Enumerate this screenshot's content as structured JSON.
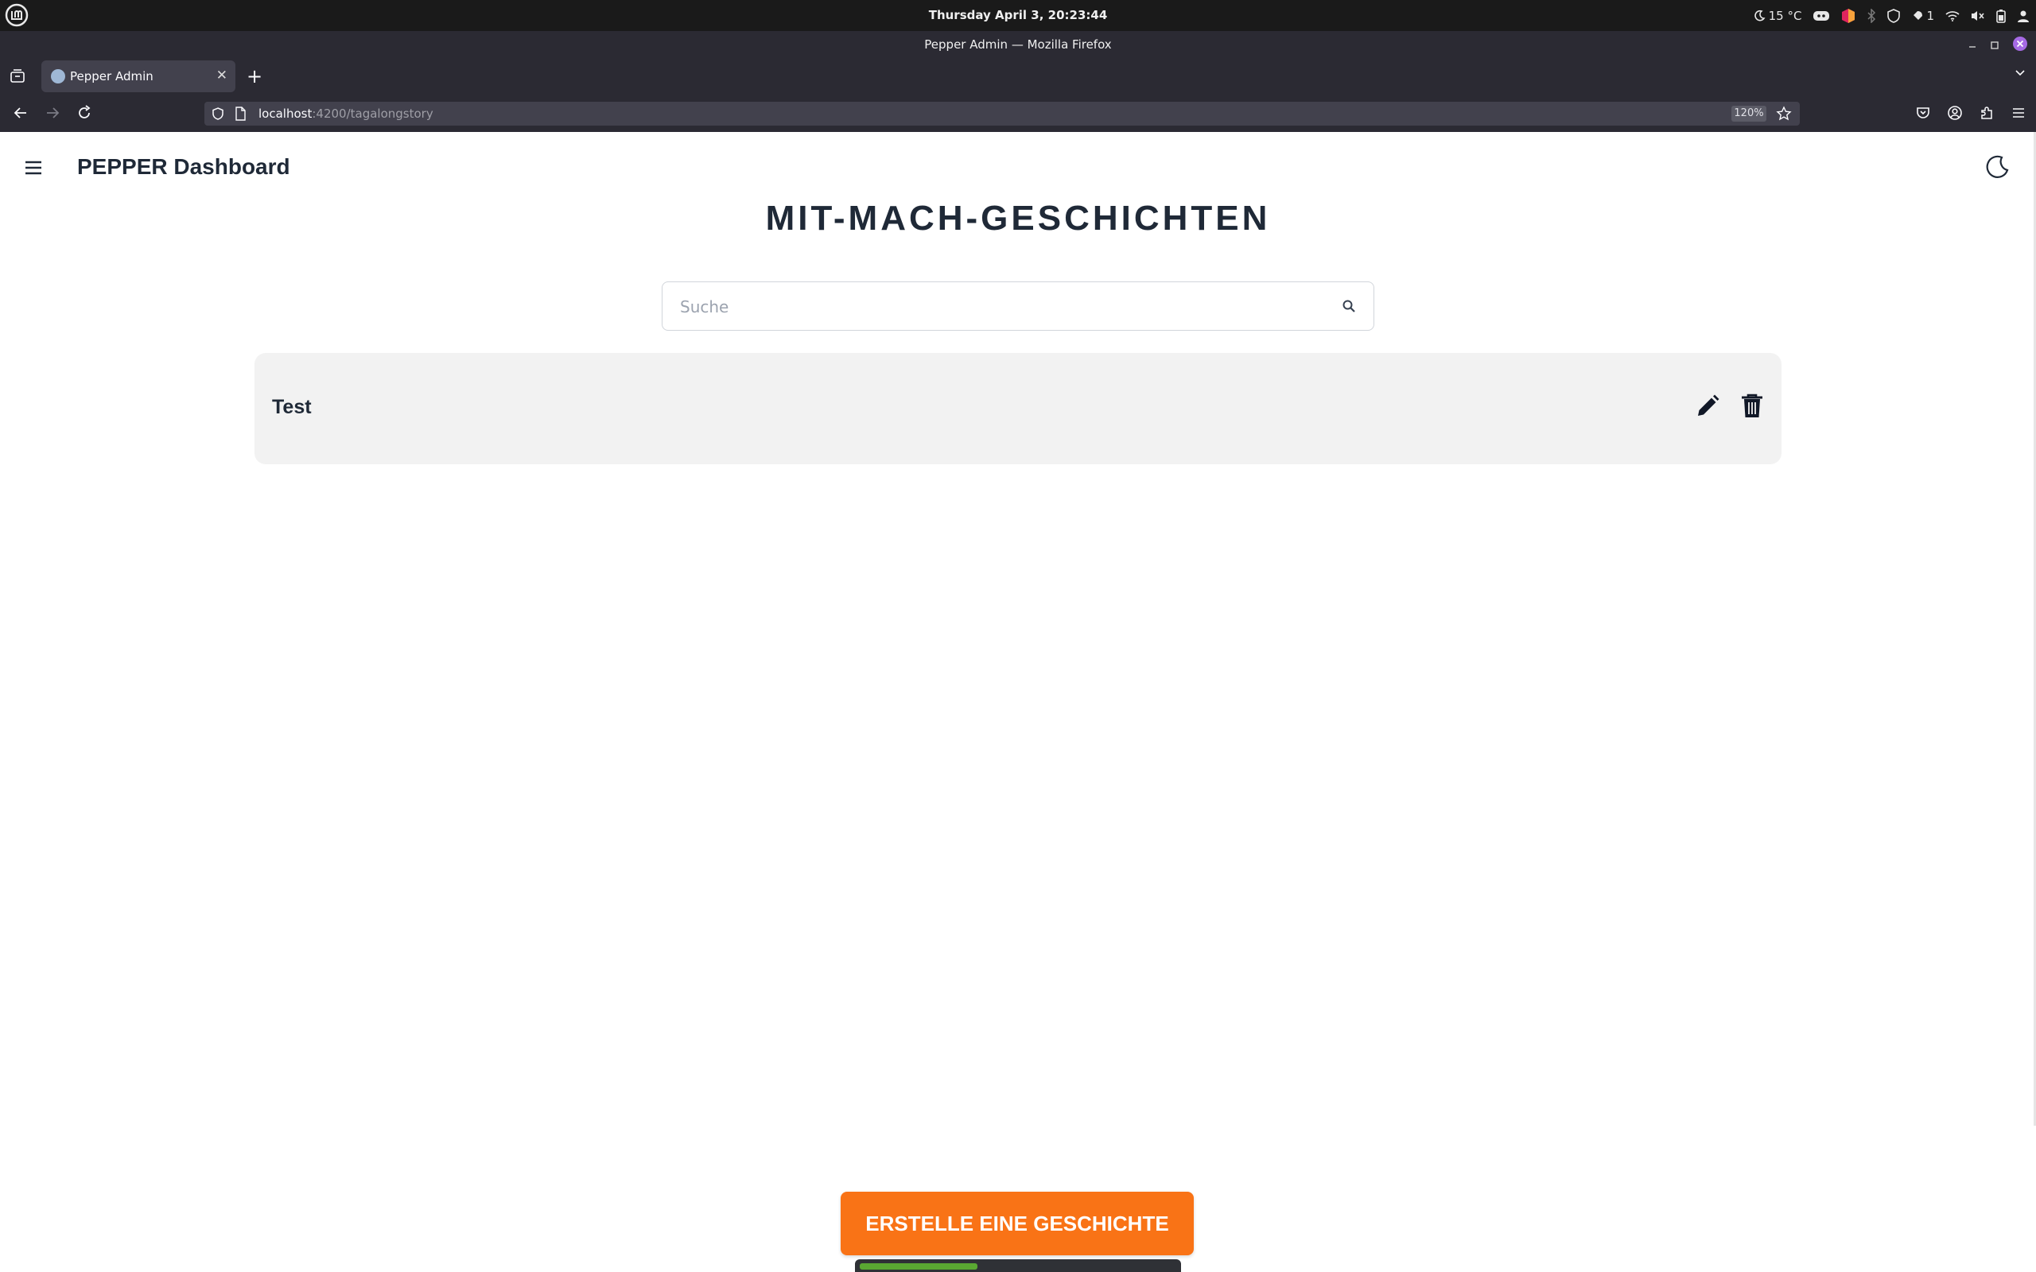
{
  "os": {
    "clock": "Thursday April 3, 20:23:44",
    "weather": "15 °C",
    "notifications": "1"
  },
  "window": {
    "title": "Pepper Admin — Mozilla Firefox"
  },
  "browser": {
    "tab_title": "Pepper Admin",
    "url_host": "localhost",
    "url_path": ":4200/tagalongstory",
    "zoom": "120%"
  },
  "app": {
    "brand": "PEPPER Dashboard",
    "page_title": "MIT-MACH-GESCHICHTEN",
    "search": {
      "placeholder": "Suche",
      "value": ""
    },
    "stories": [
      {
        "title": "Test"
      }
    ],
    "create_label": "ERSTELLE EINE GESCHICHTE",
    "progress": 0.36
  },
  "colors": {
    "accent": "#f97316",
    "text_dark": "#1f2937",
    "card_bg": "#f2f2f2"
  }
}
